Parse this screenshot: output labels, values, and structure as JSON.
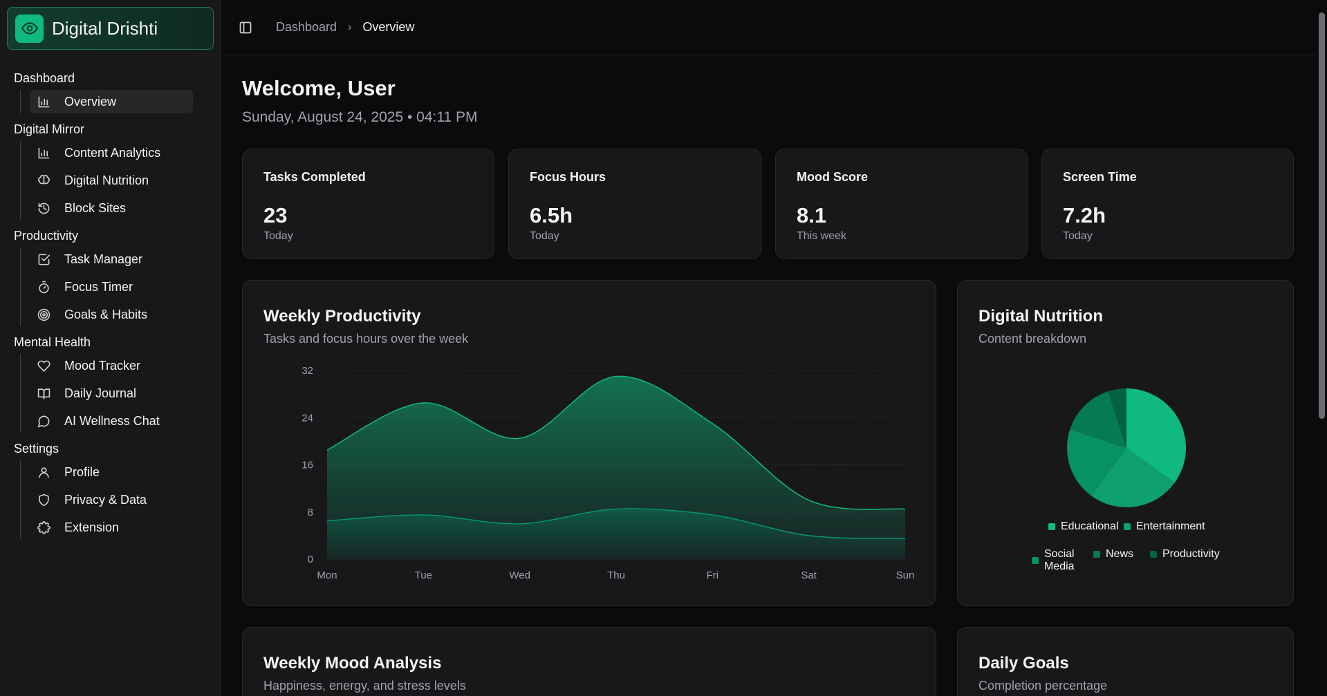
{
  "brand": {
    "name": "Digital Drishti",
    "accent": "#10b981"
  },
  "sidebar": {
    "groups": [
      {
        "title": "Dashboard",
        "items": [
          {
            "label": "Overview",
            "icon": "bar-chart-icon",
            "active": true
          }
        ]
      },
      {
        "title": "Digital Mirror",
        "items": [
          {
            "label": "Content Analytics",
            "icon": "bar-chart-icon"
          },
          {
            "label": "Digital Nutrition",
            "icon": "brain-icon"
          },
          {
            "label": "Block Sites",
            "icon": "history-icon"
          }
        ]
      },
      {
        "title": "Productivity",
        "items": [
          {
            "label": "Task Manager",
            "icon": "checkbox-icon"
          },
          {
            "label": "Focus Timer",
            "icon": "timer-icon"
          },
          {
            "label": "Goals & Habits",
            "icon": "target-icon"
          }
        ]
      },
      {
        "title": "Mental Health",
        "items": [
          {
            "label": "Mood Tracker",
            "icon": "heart-icon"
          },
          {
            "label": "Daily Journal",
            "icon": "book-icon"
          },
          {
            "label": "AI Wellness Chat",
            "icon": "chat-icon"
          }
        ]
      },
      {
        "title": "Settings",
        "items": [
          {
            "label": "Profile",
            "icon": "user-icon"
          },
          {
            "label": "Privacy & Data",
            "icon": "shield-icon"
          },
          {
            "label": "Extension",
            "icon": "puzzle-icon"
          }
        ]
      }
    ]
  },
  "breadcrumb": {
    "parent": "Dashboard",
    "separator": "›",
    "current": "Overview"
  },
  "welcome": {
    "title": "Welcome, User",
    "datetime": "Sunday, August 24, 2025 • 04:11 PM"
  },
  "stats": [
    {
      "label": "Tasks Completed",
      "value": "23",
      "sub": "Today"
    },
    {
      "label": "Focus Hours",
      "value": "6.5h",
      "sub": "Today"
    },
    {
      "label": "Mood Score",
      "value": "8.1",
      "sub": "This week"
    },
    {
      "label": "Screen Time",
      "value": "7.2h",
      "sub": "Today"
    }
  ],
  "productivity_panel": {
    "title": "Weekly Productivity",
    "subtitle": "Tasks and focus hours over the week"
  },
  "nutrition_panel": {
    "title": "Digital Nutrition",
    "subtitle": "Content breakdown"
  },
  "mood_panel": {
    "title": "Weekly Mood Analysis",
    "subtitle": "Happiness, energy, and stress levels"
  },
  "goals_panel": {
    "title": "Daily Goals",
    "subtitle": "Completion percentage"
  },
  "chart_data": [
    {
      "type": "area",
      "categories": [
        "Mon",
        "Tue",
        "Wed",
        "Thu",
        "Fri",
        "Sat",
        "Sun"
      ],
      "ylim": [
        0,
        32
      ],
      "yticks": [
        0,
        8,
        16,
        24,
        32
      ],
      "grid": true,
      "series": [
        {
          "values": [
            18.5,
            26.5,
            20.5,
            31,
            23,
            10,
            8.5
          ],
          "color": "#10b981"
        },
        {
          "values": [
            6.5,
            7.5,
            6,
            8.5,
            7.5,
            4,
            3.5
          ],
          "color": "#059669"
        }
      ]
    },
    {
      "type": "pie",
      "labels": [
        "Educational",
        "Entertainment",
        "Social Media",
        "News",
        "Productivity"
      ],
      "values": [
        35,
        25,
        20,
        15,
        5
      ],
      "colors": [
        "#10b981",
        "#0ea06f",
        "#089163",
        "#057a53",
        "#046244"
      ],
      "legend": "bottom"
    }
  ]
}
